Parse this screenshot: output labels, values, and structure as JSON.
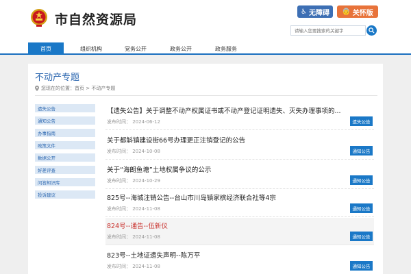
{
  "site": {
    "title": "市自然资源局",
    "accessibility_label": "无障碍",
    "care_label": "关怀版",
    "search_placeholder": "请输入您要搜索的关键字"
  },
  "nav": [
    "首页",
    "组织机构",
    "党务公开",
    "政务公开",
    "政务服务"
  ],
  "page": {
    "title": "不动产专题",
    "breadcrumb": "您现在的位置：首页 > 不动产专题"
  },
  "sidebar": [
    "遗失公告",
    "通知公告",
    "办事指南",
    "政策文件",
    "数据公开",
    "好差评查",
    "问答知识库",
    "投诉建议"
  ],
  "list": [
    {
      "title": "【遗失公告】关于调整不动产权属证书或不动产登记证明遗失、灭失办理事项的...",
      "date": "发布时间： 2024-06-12",
      "tag": "遗失公告"
    },
    {
      "title": "关于都斛镇建设街66号办理更正注销登记的公告",
      "date": "发布时间： 2024-10-08",
      "tag": "通知公告"
    },
    {
      "title": "关于“海朗鱼塘”土地权属争议的公示",
      "date": "发布时间： 2024-10-29",
      "tag": "通知公告"
    },
    {
      "title": "825号--海城注销公告--台山市川岛镇家槟经济联合社等4宗",
      "date": "发布时间： 2024-11-08",
      "tag": "通知公告"
    },
    {
      "title": "824号--通告--伍新仪",
      "date": "发布时间： 2024-11-08",
      "tag": "通知公告"
    },
    {
      "title": "823号--土地证遗失声明--陈万平",
      "date": "发布时间： 2024-11-08",
      "tag": "通知公告"
    }
  ]
}
